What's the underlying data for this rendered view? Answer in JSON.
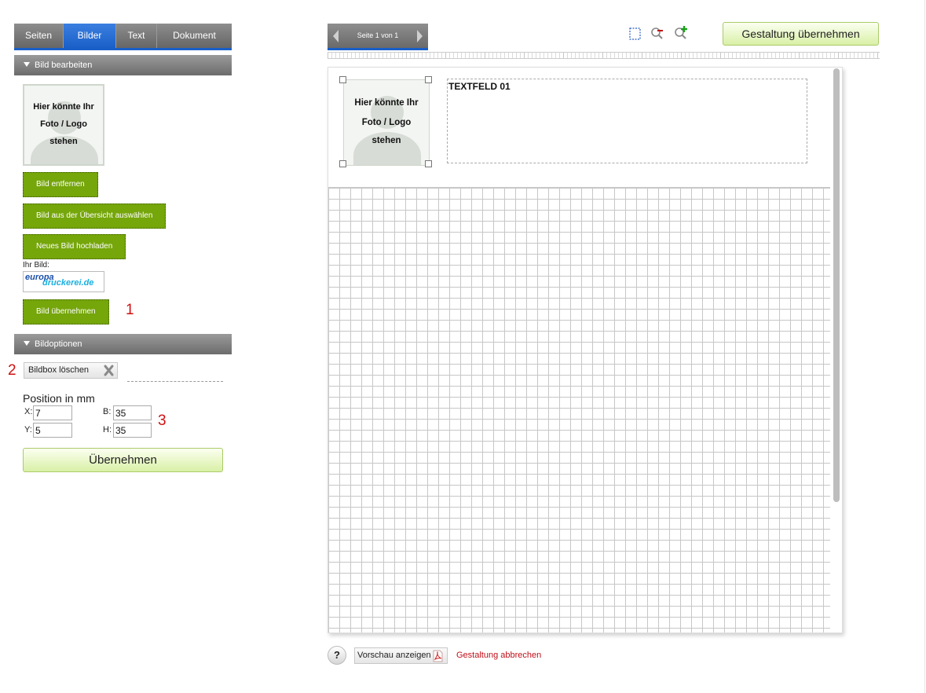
{
  "tabs": [
    {
      "label": "Seiten",
      "active": false
    },
    {
      "label": "Bilder",
      "active": true
    },
    {
      "label": "Text",
      "active": false
    },
    {
      "label": "Dokument",
      "active": false
    }
  ],
  "edit_section": {
    "title": "Bild bearbeiten",
    "placeholder_lines": [
      "Hier könnte Ihr",
      "Foto / Logo",
      "stehen"
    ],
    "buttons": {
      "remove": "Bild entfernen",
      "choose": "Bild aus der Übersicht auswählen",
      "upload": "Neues Bild hochladen",
      "apply_image": "Bild übernehmen"
    },
    "your_image_label": "Ihr Bild:",
    "logo": {
      "line1": "europa",
      "line2": "druckerei.de"
    }
  },
  "options_section": {
    "title": "Bildoptionen",
    "delete_box": "Bildbox löschen",
    "position_title": "Position in mm",
    "fields": {
      "x_label": "X:",
      "x_value": "7",
      "y_label": "Y:",
      "y_value": "5",
      "b_label": "B:",
      "b_value": "35",
      "h_label": "H:",
      "h_value": "35"
    },
    "apply": "Übernehmen"
  },
  "annotations": {
    "one": "1",
    "two": "2",
    "three": "3"
  },
  "toolbar": {
    "page_indicator": "Seite 1 von 1",
    "apply_design": "Gestaltung übernehmen",
    "icons": [
      "selection-icon",
      "zoom-out-icon",
      "zoom-in-icon"
    ]
  },
  "canvas": {
    "placeholder_lines": [
      "Hier könnte Ihr",
      "Foto / Logo",
      "stehen"
    ],
    "textfield_label": "TEXTFELD 01"
  },
  "footer": {
    "help": "?",
    "preview": "Vorschau anzeigen",
    "cancel": "Gestaltung abbrechen"
  },
  "colors": {
    "tab_active": "#1a5fc8",
    "green_button": "#75a60a",
    "annotation_red": "#d01010",
    "cancel_link": "#c0101a"
  }
}
